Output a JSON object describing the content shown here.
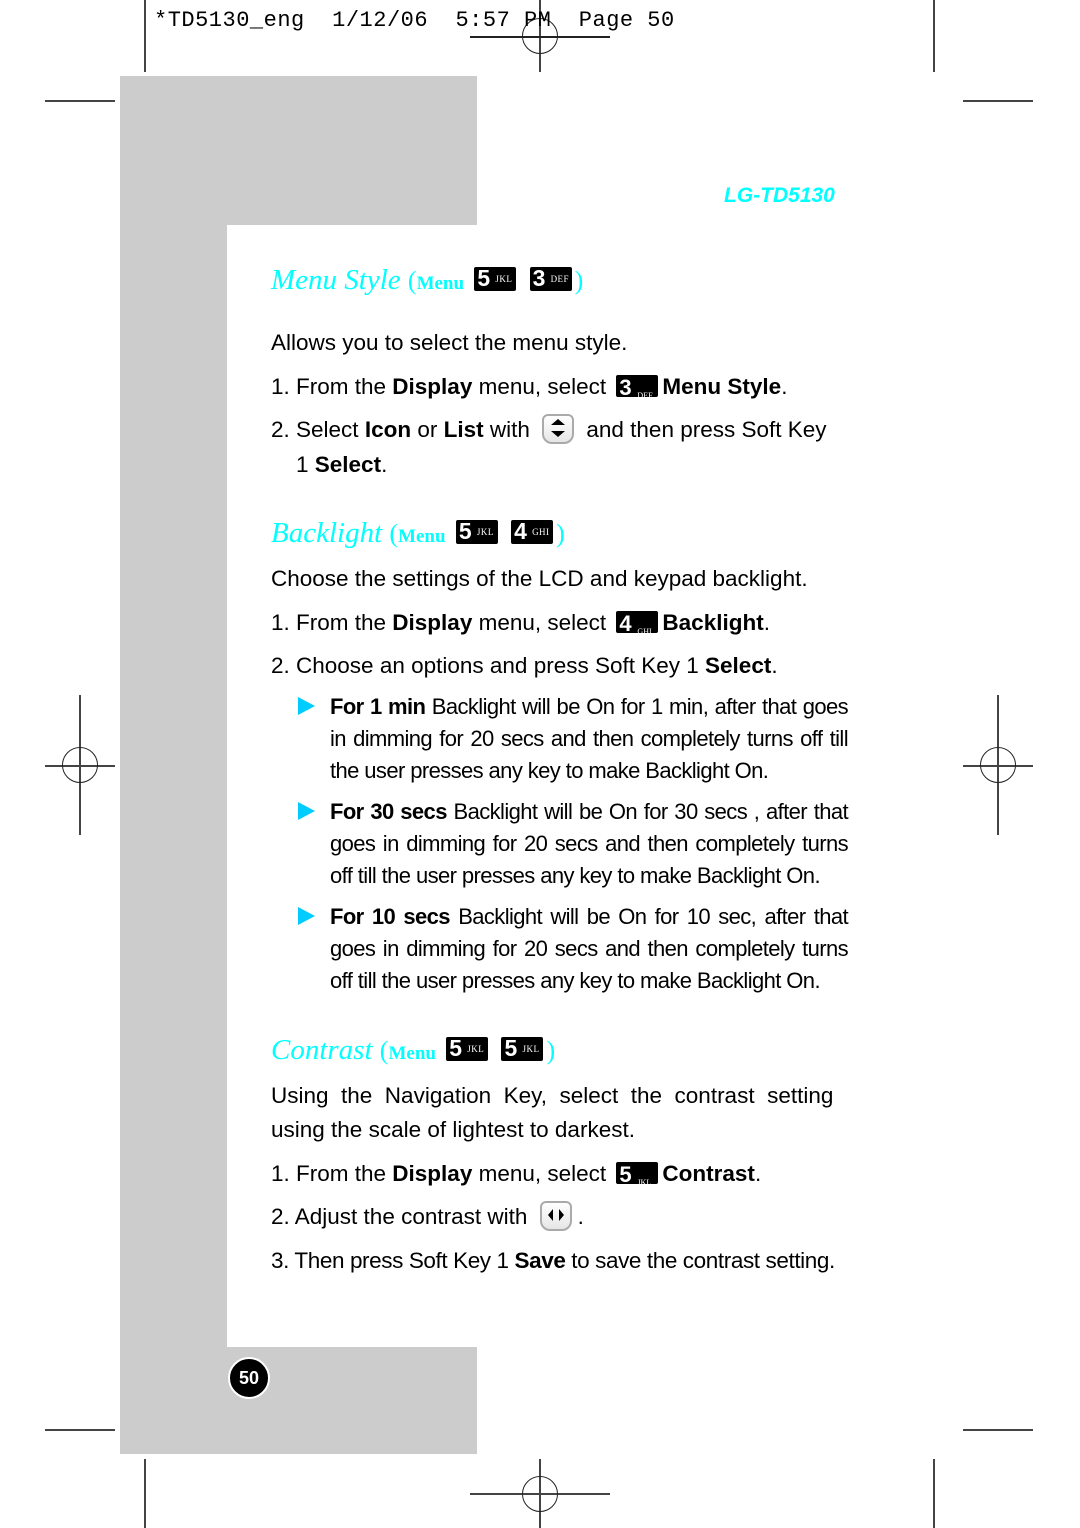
{
  "slug": {
    "filename": "*TD5130_eng",
    "date": "1/12/06",
    "time": "5:57 PM",
    "page": "Page 50"
  },
  "brand": "LG-TD5130",
  "sections": {
    "menu_style": {
      "title": "Menu Style",
      "menu_label": "Menu",
      "keys": [
        {
          "num": "5",
          "letters": "JKL"
        },
        {
          "num": "3",
          "letters": "DEF"
        }
      ],
      "intro": "Allows you to select the menu style.",
      "step1": {
        "prefix": "1. From the ",
        "bold1": "Display",
        "mid": " menu, select ",
        "key": {
          "num": "3",
          "letters": "DEF"
        },
        "bold2": "Menu Style",
        "suffix": "."
      },
      "step2": {
        "prefix": "2. Select ",
        "bold1": "Icon",
        "mid1": " or ",
        "bold2": "List",
        "mid2": " with ",
        "icon": "up-down-nav-key-icon",
        "suffix": " and then press Soft Key",
        "line2_prefix": "1 ",
        "line2_bold": "Select",
        "line2_suffix": "."
      }
    },
    "backlight": {
      "title": "Backlight",
      "menu_label": "Menu",
      "keys": [
        {
          "num": "5",
          "letters": "JKL"
        },
        {
          "num": "4",
          "letters": "GHI"
        }
      ],
      "intro": "Choose the settings of the LCD and keypad backlight.",
      "step1": {
        "prefix": "1. From the ",
        "bold1": "Display",
        "mid": " menu, select ",
        "key": {
          "num": "4",
          "letters": "GHI"
        },
        "bold2": "Backlight",
        "suffix": "."
      },
      "step2": {
        "prefix": "2. Choose an options and press Soft Key 1 ",
        "bold": "Select",
        "suffix": "."
      },
      "options": [
        {
          "label": "For 1 min",
          "text": "Backlight will be On for 1 min, after that goes in dimming for 20 secs and then completely turns off till the user presses any key to make Backlight On."
        },
        {
          "label": "For 30 secs",
          "text": "Backlight will be On for 30 secs , after that goes in dimming for 20 secs and then completely turns off till the user presses any key to make Backlight On."
        },
        {
          "label": "For 10 secs",
          "text": "Backlight will be On for 10 sec, after that goes in dimming for 20 secs and then completely turns off till the user presses any key to make Backlight On."
        }
      ]
    },
    "contrast": {
      "title": "Contrast",
      "menu_label": "Menu",
      "keys": [
        {
          "num": "5",
          "letters": "JKL"
        },
        {
          "num": "5",
          "letters": "JKL"
        }
      ],
      "intro_line1": "Using  the  Navigation  Key,  select  the  contrast  setting",
      "intro_line2": "using the scale of lightest to darkest.",
      "step1": {
        "prefix": "1. From the ",
        "bold1": "Display",
        "mid": " menu, select ",
        "key": {
          "num": "5",
          "letters": "JKL"
        },
        "bold2": "Contrast",
        "suffix": "."
      },
      "step2": {
        "prefix": "2. Adjust the contrast with ",
        "icon": "left-right-nav-key-icon",
        "suffix": "."
      },
      "step3": {
        "prefix": "3. Then press Soft Key 1 ",
        "bold": "Save",
        "suffix": " to save the contrast setting."
      }
    }
  },
  "page_number": "50",
  "colors": {
    "accent": "#00ffff",
    "bullet": "#00ccff",
    "gray_panel": "#cccccc"
  }
}
